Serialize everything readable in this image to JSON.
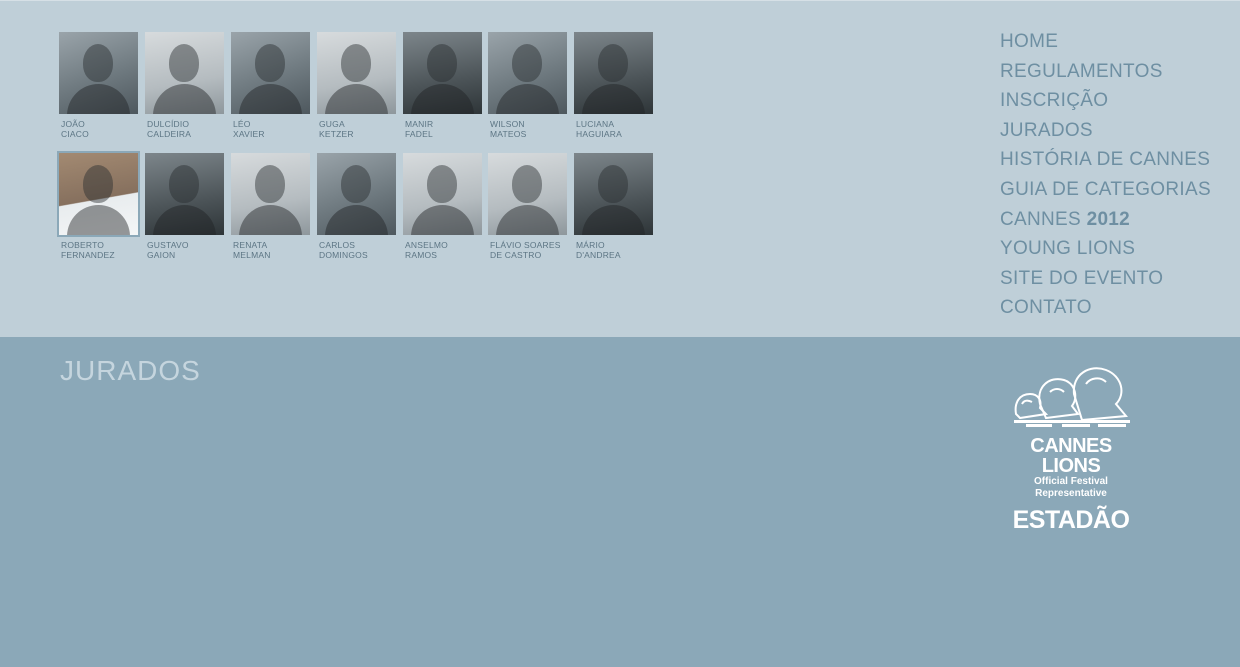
{
  "jurors_row1": [
    {
      "name": "JOÃO\nCIACO"
    },
    {
      "name": "DULCÍDIO\nCALDEIRA"
    },
    {
      "name": "LÉO\nXAVIER"
    },
    {
      "name": "GUGA\nKETZER"
    },
    {
      "name": "MANIR\nFADEL"
    },
    {
      "name": "WILSON\nMATEOS"
    },
    {
      "name": "LUCIANA\nHAGUIARA"
    }
  ],
  "jurors_row2": [
    {
      "name": "ROBERTO\nFERNANDEZ"
    },
    {
      "name": "GUSTAVO\nGAION"
    },
    {
      "name": "RENATA\nMELMAN"
    },
    {
      "name": "CARLOS\nDOMINGOS"
    },
    {
      "name": "ANSELMO\nRAMOS"
    },
    {
      "name": "FLÁVIO SOARES\nDE CASTRO"
    },
    {
      "name": "MÁRIO\nD'ANDREA"
    }
  ],
  "nav": {
    "home": "HOME",
    "regulamentos": "REGULAMENTOS",
    "inscricao": "INSCRIÇÃO",
    "jurados": "JURADOS",
    "historia": "HISTÓRIA DE CANNES",
    "guia": "GUIA DE CATEGORIAS",
    "cannes_prefix": "CANNES",
    "cannes_year": "2012",
    "young": "YOUNG LIONS",
    "site": "SITE DO EVENTO",
    "contato": "CONTATO"
  },
  "section": {
    "title": "JURADOS"
  },
  "logo": {
    "brand": "CANNES LIONS",
    "tagline": "Official Festival Representative",
    "sponsor": "ESTADÃO"
  },
  "colors": {
    "top_background": "#bfcfd8",
    "bottom_background": "#8ba8b8",
    "nav_text": "#6e8fa2",
    "caption_text": "#5c7584"
  }
}
